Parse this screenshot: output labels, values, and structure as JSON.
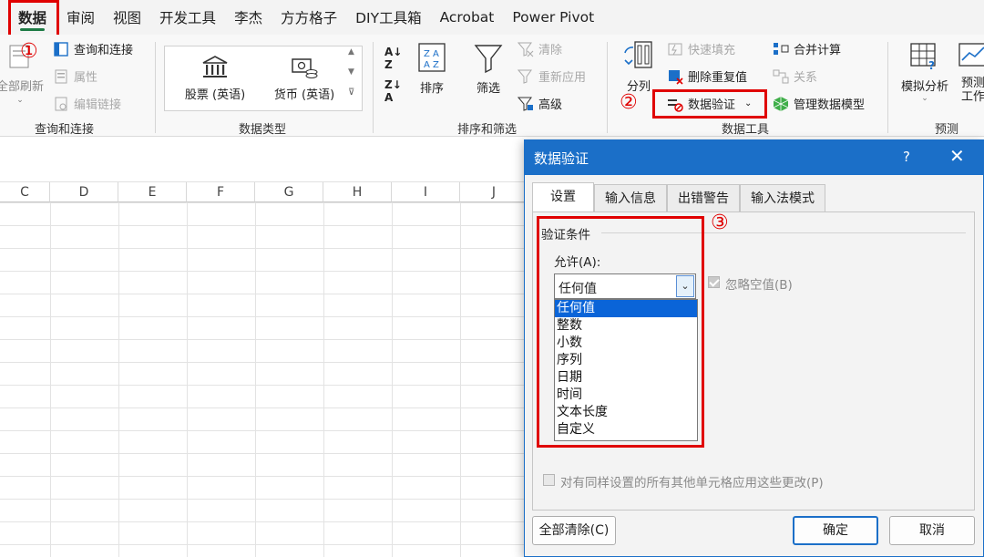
{
  "tabs": [
    {
      "label": "数据",
      "active": true
    },
    {
      "label": "审阅"
    },
    {
      "label": "视图"
    },
    {
      "label": "开发工具"
    },
    {
      "label": "李杰"
    },
    {
      "label": "方方格子"
    },
    {
      "label": "DIY工具箱"
    },
    {
      "label": "Acrobat"
    },
    {
      "label": "Power Pivot"
    }
  ],
  "ribbon": {
    "query": {
      "refresh_all": "全部刷新",
      "query_conn": "查询和连接",
      "properties": "属性",
      "edit_links": "编辑链接",
      "group": "查询和连接"
    },
    "datatypes": {
      "stocks": "股票 (英语)",
      "currency": "货币 (英语)",
      "group": "数据类型"
    },
    "sort": {
      "sort": "排序",
      "filter": "筛选",
      "clear": "清除",
      "reapply": "重新应用",
      "advanced": "高级",
      "group": "排序和筛选"
    },
    "tools": {
      "text_to_cols": "分列",
      "flash_fill": "快速填充",
      "remove_dup": "删除重复值",
      "validation": "数据验证",
      "consolidate": "合并计算",
      "relations": "关系",
      "data_model": "管理数据模型",
      "group": "数据工具"
    },
    "forecast": {
      "whatif": "模拟分析",
      "forecast_sheet_1": "预测",
      "forecast_sheet_2": "工作",
      "group": "预测"
    }
  },
  "annotations": {
    "one": "①",
    "two": "②",
    "three": "③"
  },
  "columns": [
    "C",
    "D",
    "E",
    "F",
    "G",
    "H",
    "I",
    "J"
  ],
  "dialog": {
    "title": "数据验证",
    "help": "?",
    "close": "✕",
    "tabs": [
      "设置",
      "输入信息",
      "出错警告",
      "输入法模式"
    ],
    "criteria_label": "验证条件",
    "allow_label": "允许(A):",
    "allow_value": "任何值",
    "ignore_blank": "忽略空值(B)",
    "options": [
      "任何值",
      "整数",
      "小数",
      "序列",
      "日期",
      "时间",
      "文本长度",
      "自定义"
    ],
    "selected_index": 0,
    "apply_all": "对有同样设置的所有其他单元格应用这些更改(P)",
    "clear_all": "全部清除(C)",
    "ok": "确定",
    "cancel": "取消"
  },
  "colors": {
    "accent": "#1b6fc8",
    "annotation": "#e00000",
    "tab_underline": "#1e7b45"
  }
}
